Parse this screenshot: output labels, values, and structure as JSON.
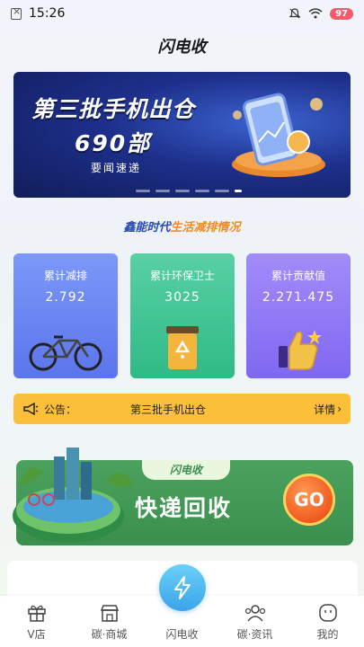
{
  "status_bar": {
    "time": "15:26",
    "battery": "97"
  },
  "header": {
    "title": "闪电收"
  },
  "banner": {
    "title": "第三批手机出仓",
    "count": "690部",
    "subtitle": "要闻速递"
  },
  "section_title": {
    "part1": "鑫能时代",
    "part2": "生活减排情况"
  },
  "stats": [
    {
      "label": "累计减排",
      "value": "2.792"
    },
    {
      "label": "累计环保卫士",
      "value": "3025"
    },
    {
      "label": "累计贡献值",
      "value": "2.271.475"
    }
  ],
  "notice": {
    "label": "公告：",
    "message": "第三批手机出仓",
    "detail": "详情"
  },
  "recycle": {
    "tag": "闪电收",
    "title": "快递回收",
    "go_label": "GO"
  },
  "tabs": [
    {
      "label": "V店",
      "icon": "gift-icon"
    },
    {
      "label": "碳·商城",
      "icon": "store-icon"
    },
    {
      "label": "闪电收",
      "icon": "lightning-icon"
    },
    {
      "label": "碳·资讯",
      "icon": "people-icon"
    },
    {
      "label": "我的",
      "icon": "face-icon"
    }
  ],
  "colors": {
    "banner_bg": "#1d2f8a",
    "card_blue": "#6c87f3",
    "card_green": "#3fc494",
    "card_purple": "#8f79f5",
    "notice_bg": "#fbbf3a",
    "recycle_green": "#42995a",
    "go_orange": "#f15a1d"
  }
}
